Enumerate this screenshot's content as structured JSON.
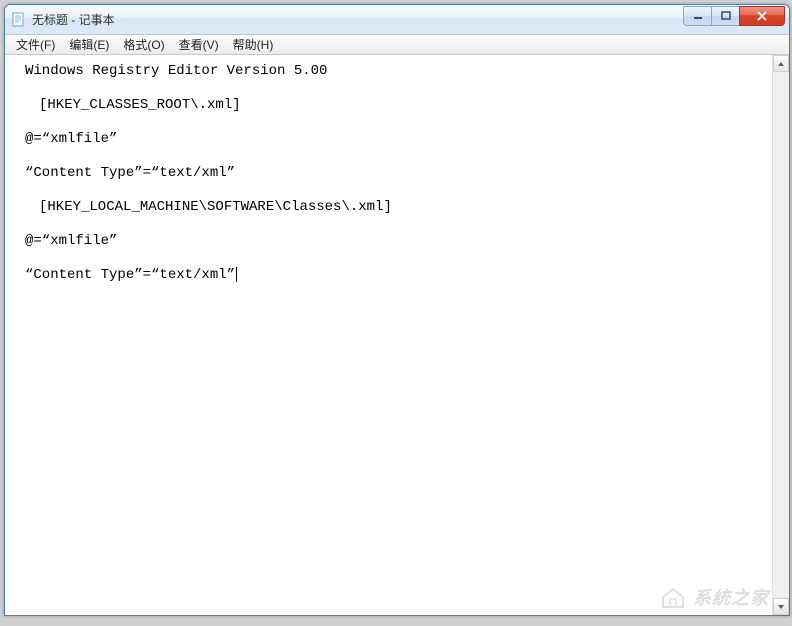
{
  "window": {
    "title": "无标题 - 记事本"
  },
  "menu": {
    "file": "文件(F)",
    "edit": "编辑(E)",
    "format": "格式(O)",
    "view": "查看(V)",
    "help": "帮助(H)"
  },
  "editor": {
    "lines": [
      "Windows Registry Editor Version 5.00",
      "",
      "　[HKEY_CLASSES_ROOT\\.xml]",
      "",
      "@=“xmlfile”",
      "",
      "“Content Type”=“text/xml”",
      "",
      "　[HKEY_LOCAL_MACHINE\\SOFTWARE\\Classes\\.xml]",
      "",
      "@=“xmlfile”",
      "",
      "“Content Type”=“text/xml”"
    ]
  },
  "watermark": {
    "text": "系统之家"
  }
}
